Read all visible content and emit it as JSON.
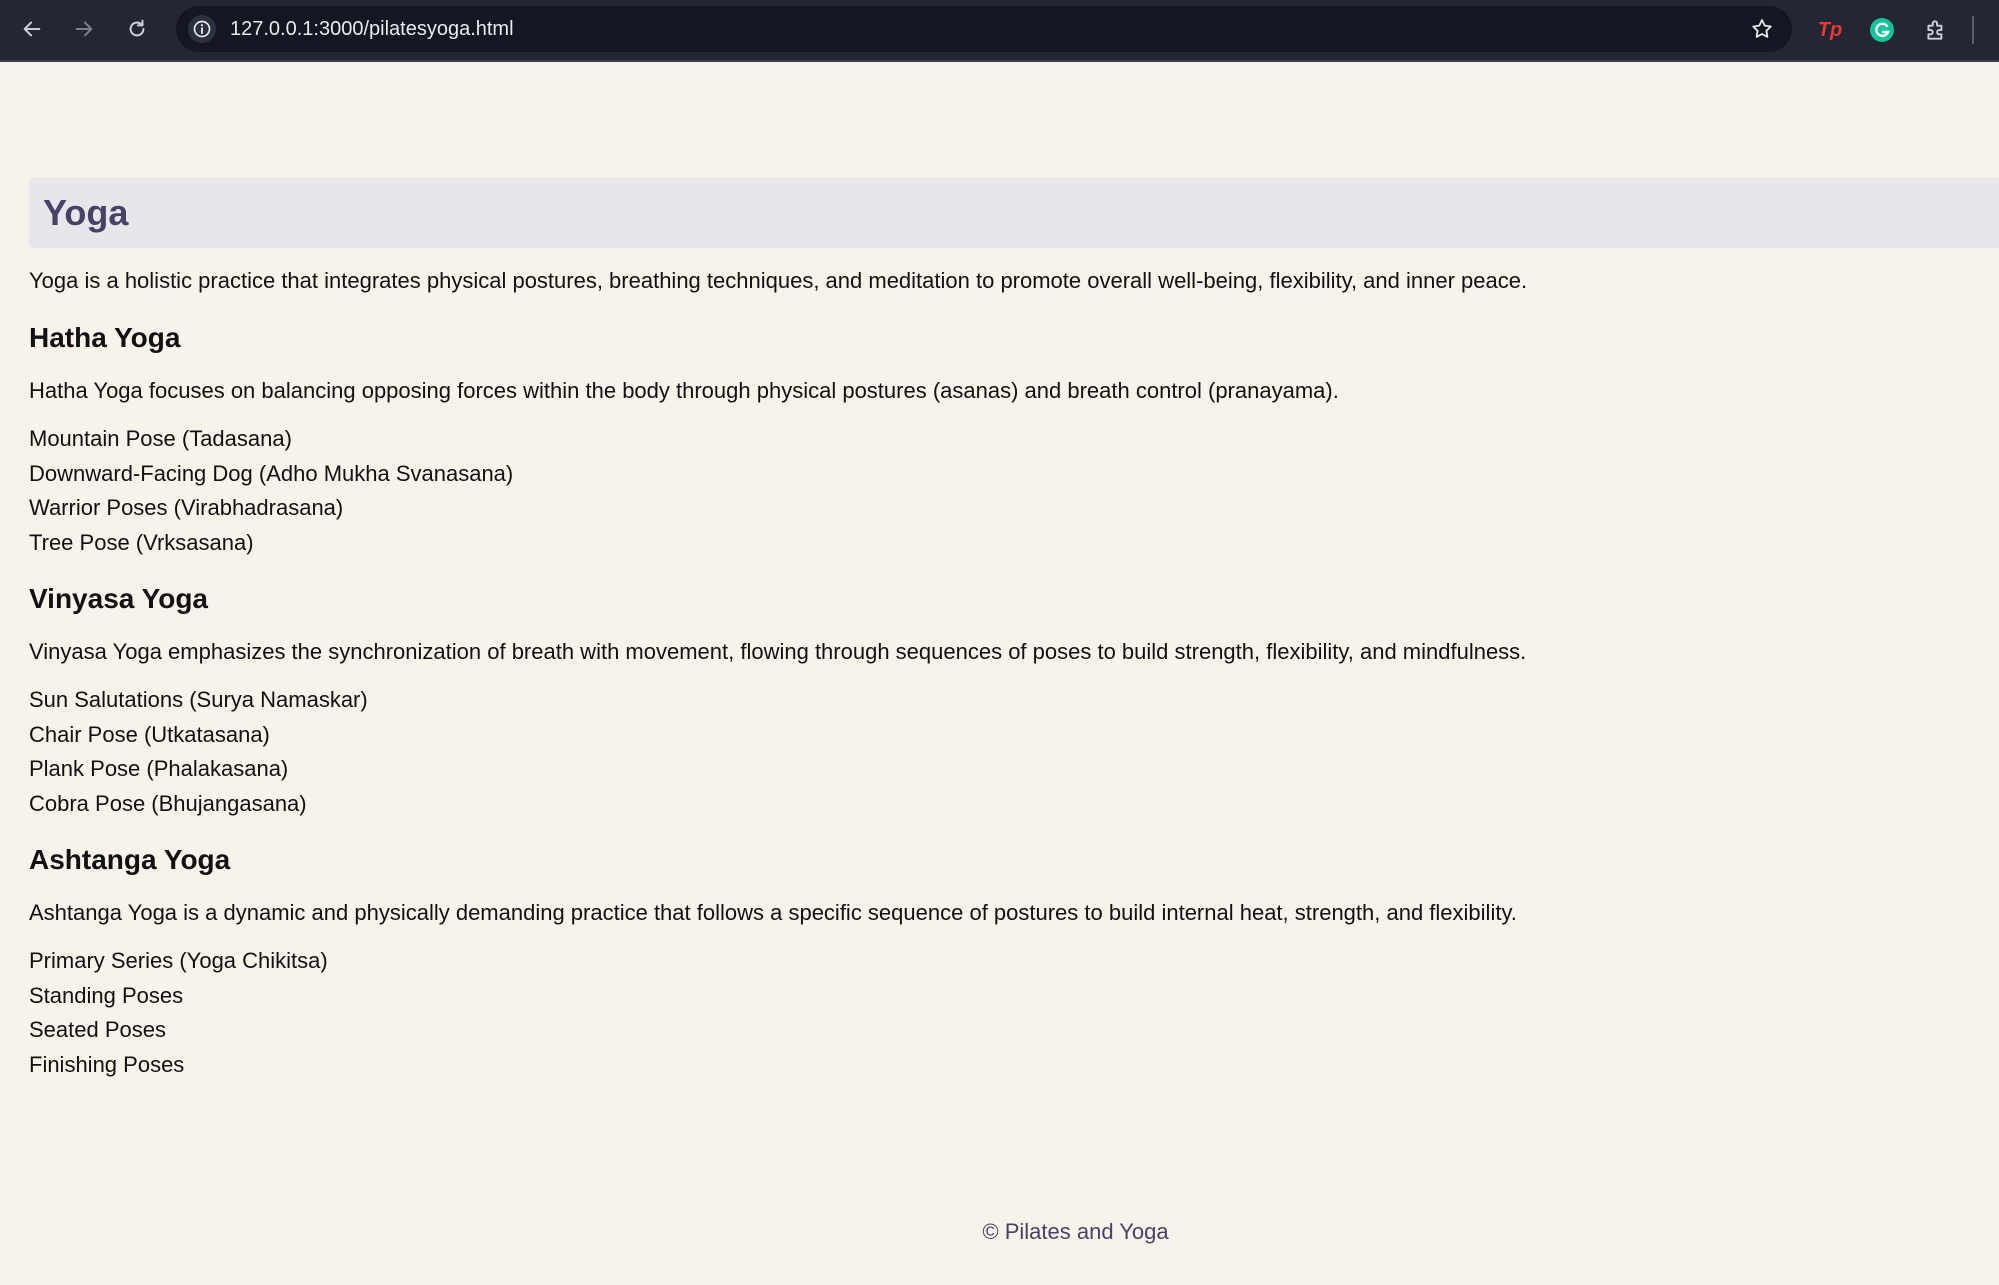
{
  "browser": {
    "url": "127.0.0.1:3000/pilatesyoga.html",
    "extensions": [
      {
        "name": "tp-extension-icon",
        "label": "Tp"
      },
      {
        "name": "grammarly-icon",
        "label": ""
      },
      {
        "name": "puzzle-extensions-icon",
        "label": ""
      }
    ]
  },
  "page": {
    "title": "Yoga",
    "intro": "Yoga is a holistic practice that integrates physical postures, breathing techniques, and meditation to promote overall well-being, flexibility, and inner peace.",
    "sections": [
      {
        "heading": "Hatha Yoga",
        "description": "Hatha Yoga focuses on balancing opposing forces within the body through physical postures (asanas) and breath control (pranayama).",
        "items": [
          "Mountain Pose (Tadasana)",
          "Downward-Facing Dog (Adho Mukha Svanasana)",
          "Warrior Poses (Virabhadrasana)",
          "Tree Pose (Vrksasana)"
        ]
      },
      {
        "heading": "Vinyasa Yoga",
        "description": "Vinyasa Yoga emphasizes the synchronization of breath with movement, flowing through sequences of poses to build strength, flexibility, and mindfulness.",
        "items": [
          "Sun Salutations (Surya Namaskar)",
          "Chair Pose (Utkatasana)",
          "Plank Pose (Phalakasana)",
          "Cobra Pose (Bhujangasana)"
        ]
      },
      {
        "heading": "Ashtanga Yoga",
        "description": "Ashtanga Yoga is a dynamic and physically demanding practice that follows a specific sequence of postures to build internal heat, strength, and flexibility.",
        "items": [
          "Primary Series (Yoga Chikitsa)",
          "Standing Poses",
          "Seated Poses",
          "Finishing Poses"
        ]
      }
    ],
    "footer": "© Pilates and Yoga"
  },
  "colors": {
    "page_background": "#f8f3ea",
    "header_background": "#e8e6ea",
    "title_color": "#4a4266",
    "chrome_background": "#222733"
  }
}
